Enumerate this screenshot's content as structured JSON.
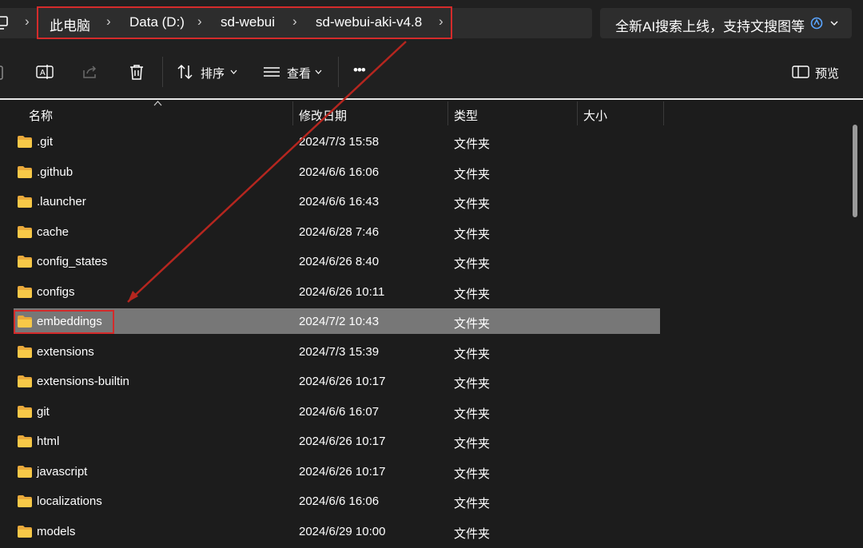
{
  "breadcrumb": {
    "items": [
      "此电脑",
      "Data (D:)",
      "sd-webui",
      "sd-webui-aki-v4.8"
    ]
  },
  "search": {
    "text": "全新AI搜索上线，支持文搜图等"
  },
  "toolbar": {
    "sort_label": "排序",
    "view_label": "查看",
    "more_label": "•••",
    "preview_label": "预览"
  },
  "columns": {
    "name": "名称",
    "date": "修改日期",
    "type": "类型",
    "size": "大小"
  },
  "files": [
    {
      "name": ".git",
      "date": "2024/7/3 15:58",
      "type": "文件夹"
    },
    {
      "name": ".github",
      "date": "2024/6/6 16:06",
      "type": "文件夹"
    },
    {
      "name": ".launcher",
      "date": "2024/6/6 16:43",
      "type": "文件夹"
    },
    {
      "name": "cache",
      "date": "2024/6/28 7:46",
      "type": "文件夹"
    },
    {
      "name": "config_states",
      "date": "2024/6/26 8:40",
      "type": "文件夹"
    },
    {
      "name": "configs",
      "date": "2024/6/26 10:11",
      "type": "文件夹"
    },
    {
      "name": "embeddings",
      "date": "2024/7/2 10:43",
      "type": "文件夹",
      "selected": true
    },
    {
      "name": "extensions",
      "date": "2024/7/3 15:39",
      "type": "文件夹"
    },
    {
      "name": "extensions-builtin",
      "date": "2024/6/26 10:17",
      "type": "文件夹"
    },
    {
      "name": "git",
      "date": "2024/6/6 16:07",
      "type": "文件夹"
    },
    {
      "name": "html",
      "date": "2024/6/26 10:17",
      "type": "文件夹"
    },
    {
      "name": "javascript",
      "date": "2024/6/26 10:17",
      "type": "文件夹"
    },
    {
      "name": "localizations",
      "date": "2024/6/6 16:06",
      "type": "文件夹"
    },
    {
      "name": "models",
      "date": "2024/6/29 10:00",
      "type": "文件夹"
    }
  ],
  "colors": {
    "highlight": "#d42b2b",
    "folder": "#f7c948",
    "selected_row": "#777777"
  }
}
